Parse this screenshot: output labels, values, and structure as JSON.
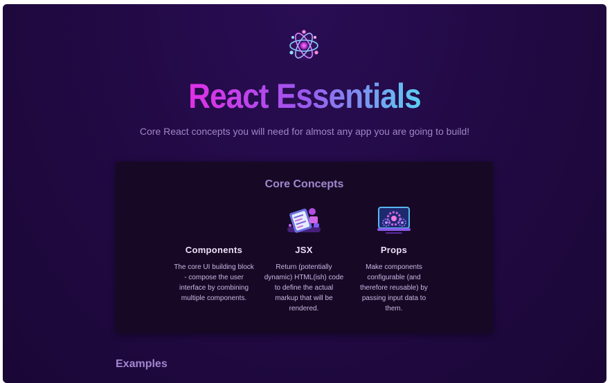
{
  "header": {
    "logo_icon": "react-atom-icon",
    "title": "React Essentials",
    "subtitle": "Core React concepts you will need for almost any app you are going to build!"
  },
  "core_concepts": {
    "heading": "Core Concepts",
    "items": [
      {
        "icon": "components-illustration-icon",
        "title": "Components",
        "description": "The core UI building block - compose the user interface by combining multiple components."
      },
      {
        "icon": "jsx-illustration-icon",
        "title": "JSX",
        "description": "Return (potentially dynamic) HTML(ish) code to define the actual markup that will be rendered."
      },
      {
        "icon": "props-illustration-icon",
        "title": "Props",
        "description": "Make components configurable (and therefore reusable) by passing input data to them."
      }
    ]
  },
  "examples": {
    "heading": "Examples"
  },
  "colors": {
    "background": "#220a45",
    "panel": "#170925",
    "title_gradient_start": "#e030e6",
    "title_gradient_end": "#5ad0f2",
    "heading": "#a187cf"
  }
}
